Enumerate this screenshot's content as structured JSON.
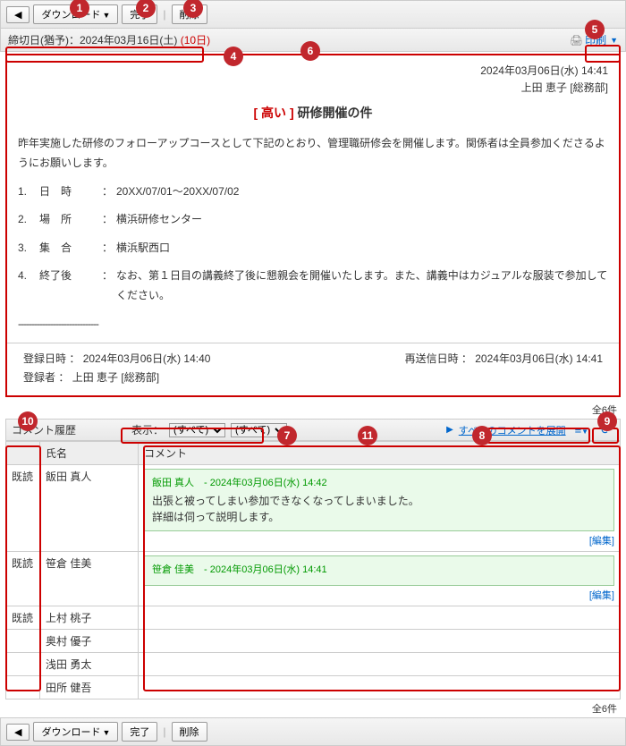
{
  "toolbar": {
    "download": "ダウンロード",
    "complete": "完了",
    "delete": "削除"
  },
  "deadline": {
    "label": "締切日(猶予)：",
    "date": "2024年03月16日(土)",
    "days": "(10日)"
  },
  "print": "印刷",
  "header": {
    "datetime": "2024年03月06日(水) 14:41",
    "author": "上田 恵子 [総務部]"
  },
  "subject": {
    "priority": "[ 高い ]",
    "title": "研修開催の件"
  },
  "intro": "昨年実施した研修のフォローアップコースとして下記のとおり、管理職研修会を開催します。関係者は全員参加くださるようにお願いします。",
  "items": [
    {
      "num": "1.",
      "label": "日　時",
      "colon": "：",
      "val": "20XX/07/01～20XX/07/02"
    },
    {
      "num": "2.",
      "label": "場　所",
      "colon": "：",
      "val": "横浜研修センター"
    },
    {
      "num": "3.",
      "label": "集　合",
      "colon": "：",
      "val": "横浜駅西口"
    },
    {
      "num": "4.",
      "label": "終了後",
      "colon": "：",
      "val": "なお、第１日目の講義終了後に懇親会を開催いたします。また、講義中はカジュアルな服装で参加してください。"
    }
  ],
  "dashline": "------------------------------",
  "footer": {
    "reg_label": "登録日時 ：",
    "reg_val": "2024年03月06日(水) 14:40",
    "resend_label": "再送信日時 ：",
    "resend_val": "2024年03月06日(水) 14:41",
    "registrant_label": "登録者 ：",
    "registrant_val": "上田 恵子 [総務部]"
  },
  "count_label": "全6件",
  "comment_section": {
    "title": "コメント履歴",
    "display_label": "表示：",
    "filter1_selected": "(すべて)",
    "filter2_selected": "(すべて)",
    "expand_all": "すべてのコメントを展開"
  },
  "columns": {
    "status": "",
    "name": "氏名",
    "comment": "コメント"
  },
  "rows": [
    {
      "status": "既読",
      "name": "飯田 真人",
      "author": "飯田 真人",
      "ts": "2024年03月06日(水) 14:42",
      "body1": "出張と被ってしまい参加できなくなってしまいました。",
      "body2": "詳細は伺って説明します。",
      "edit": "[編集]"
    },
    {
      "status": "既読",
      "name": "笹倉 佳美",
      "author": "笹倉 佳美",
      "ts": "2024年03月06日(水) 14:41",
      "body1": "",
      "body2": "",
      "edit": "[編集]"
    },
    {
      "status": "既読",
      "name": "上村 桃子"
    },
    {
      "status": "",
      "name": "奥村 優子"
    },
    {
      "status": "",
      "name": "浅田 勇太"
    },
    {
      "status": "",
      "name": "田所 健吾"
    }
  ],
  "annotations": [
    "1",
    "2",
    "3",
    "4",
    "5",
    "6",
    "7",
    "8",
    "9",
    "10",
    "11"
  ]
}
